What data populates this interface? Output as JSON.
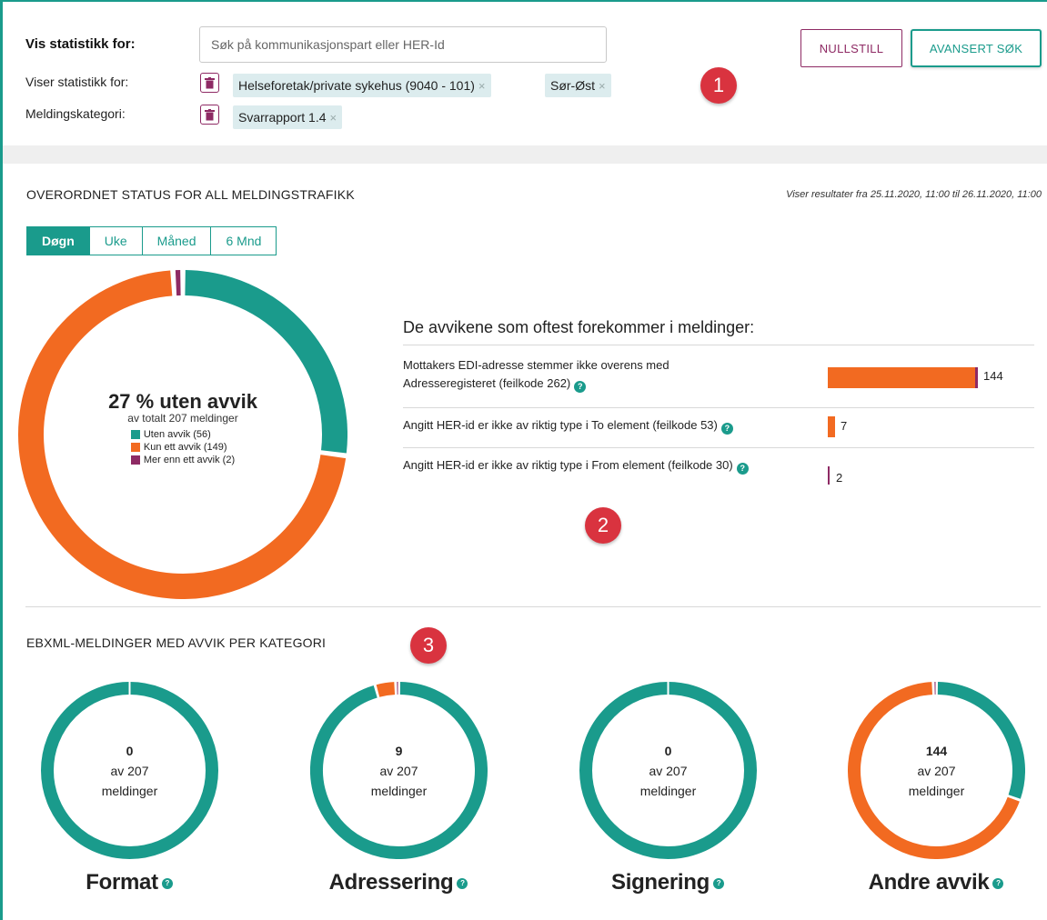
{
  "filter": {
    "vis_label": "Vis statistikk for:",
    "search_placeholder": "Søk på kommunikasjonspart eller HER-Id",
    "viser_label": "Viser statistikk for:",
    "kategori_label": "Meldingskategori:",
    "tags_viser": [
      "Helseforetak/private sykehus (9040 - 101)",
      "Sør-Øst"
    ],
    "tags_kategori": [
      "Svarrapport 1.4"
    ],
    "reset_label": "NULLSTILL",
    "advanced_label": "AVANSERT SØK"
  },
  "markers": [
    "1",
    "2",
    "3"
  ],
  "overview": {
    "title": "OVERORDNET STATUS FOR ALL MELDINGSTRAFIKK",
    "range": "Viser resultater fra 25.11.2020, 11:00 til 26.11.2020, 11:00",
    "tabs": [
      "Døgn",
      "Uke",
      "Måned",
      "6 Mnd"
    ],
    "active_tab": "Døgn",
    "center_pct": "27 % uten avvik",
    "center_sub": "av totalt 207 meldinger",
    "legend": [
      {
        "label": "Uten avvik (56)",
        "color": "#1a9b8c"
      },
      {
        "label": "Kun ett avvik (149)",
        "color": "#f26a21"
      },
      {
        "label": "Mer enn ett avvik (2)",
        "color": "#8e2a64"
      }
    ]
  },
  "chart_data": [
    {
      "type": "pie",
      "title": "27 % uten avvik",
      "subtitle": "av totalt 207 meldinger",
      "categories": [
        "Uten avvik",
        "Kun ett avvik",
        "Mer enn ett avvik"
      ],
      "values": [
        56,
        149,
        2
      ],
      "colors": [
        "#1a9b8c",
        "#f26a21",
        "#8e2a64"
      ]
    },
    {
      "type": "bar",
      "title": "De avvikene som oftest forekommer i meldinger:",
      "categories": [
        "Mottakers EDI-adresse stemmer ikke overens med Adresseregisteret (feilkode 262)",
        "Angitt HER-id er ikke av riktig type i To element (feilkode 53)",
        "Angitt HER-id er ikke av riktig type i From element (feilkode 30)"
      ],
      "values": [
        144,
        7,
        2
      ],
      "max": 144,
      "colors": [
        "#f26a21",
        "#f26a21",
        "#8e2a64"
      ]
    },
    {
      "type": "pie",
      "title": "Format",
      "values": [
        0,
        207
      ],
      "colors": [
        "#f26a21",
        "#1a9b8c"
      ]
    },
    {
      "type": "pie",
      "title": "Adressering",
      "values": [
        9,
        207
      ],
      "colors": [
        "#f26a21",
        "#1a9b8c"
      ]
    },
    {
      "type": "pie",
      "title": "Signering",
      "values": [
        0,
        207
      ],
      "colors": [
        "#f26a21",
        "#1a9b8c"
      ]
    },
    {
      "type": "pie",
      "title": "Andre avvik",
      "values": [
        144,
        207
      ],
      "colors": [
        "#f26a21",
        "#1a9b8c"
      ]
    }
  ],
  "deviations": {
    "title": "De avvikene som oftest forekommer i meldinger:",
    "items": [
      {
        "label": "Mottakers EDI-adresse stemmer ikke overens med Adresseregisteret (feilkode 262)",
        "value": "144"
      },
      {
        "label": "Angitt HER-id er ikke av riktig type i To element (feilkode 53)",
        "value": "7"
      },
      {
        "label": "Angitt HER-id er ikke av riktig type i From element (feilkode 30)",
        "value": "2"
      }
    ]
  },
  "categories": {
    "title": "EBXML-MELDINGER MED AVVIK PER KATEGORI",
    "items": [
      {
        "name": "Format",
        "count": "0",
        "of": "av 207",
        "unit": "meldinger"
      },
      {
        "name": "Adressering",
        "count": "9",
        "of": "av 207",
        "unit": "meldinger"
      },
      {
        "name": "Signering",
        "count": "0",
        "of": "av 207",
        "unit": "meldinger"
      },
      {
        "name": "Andre avvik",
        "count": "144",
        "of": "av 207",
        "unit": "meldinger"
      }
    ]
  },
  "colors": {
    "teal": "#1a9b8c",
    "orange": "#f26a21",
    "purple": "#8e2a64",
    "marker": "#d9333f"
  }
}
